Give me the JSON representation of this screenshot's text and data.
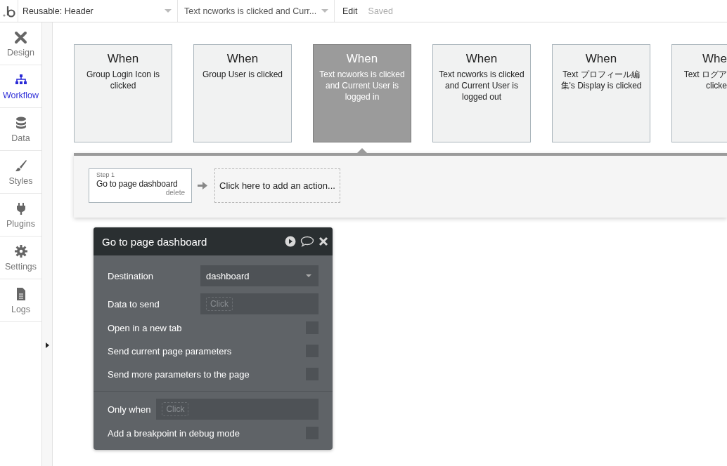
{
  "topbar": {
    "page_dropdown": "Reusable: Header",
    "event_dropdown": "Text ncworks is clicked and Curr...",
    "edit": "Edit",
    "status": "Saved"
  },
  "sidebar": {
    "items": [
      {
        "label": "Design",
        "selected": false
      },
      {
        "label": "Workflow",
        "selected": true
      },
      {
        "label": "Data",
        "selected": false
      },
      {
        "label": "Styles",
        "selected": false
      },
      {
        "label": "Plugins",
        "selected": false
      },
      {
        "label": "Settings",
        "selected": false
      },
      {
        "label": "Logs",
        "selected": false
      }
    ]
  },
  "events": [
    {
      "title": "When",
      "description": "Group Login Icon is clicked",
      "selected": false
    },
    {
      "title": "When",
      "description": "Group User is clicked",
      "selected": false
    },
    {
      "title": "When",
      "description": "Text ncworks is clicked and Current User is logged in",
      "selected": true
    },
    {
      "title": "When",
      "description": "Text ncworks is clicked and Current User is logged out",
      "selected": false
    },
    {
      "title": "When",
      "description": "Text プロフィール編集's Display is clicked",
      "selected": false
    },
    {
      "title": "Whe",
      "description": "Text ログア\nclicke",
      "selected": false
    }
  ],
  "workflow": {
    "steps": [
      {
        "step": "Step 1",
        "name": "Go to page dashboard",
        "delete": "delete"
      }
    ],
    "add_action": "Click here to add an action..."
  },
  "action_editor": {
    "title": "Go to page dashboard",
    "fields": [
      {
        "kind": "dropdown",
        "label": "Destination",
        "value": "dashboard"
      },
      {
        "kind": "expression",
        "label": "Data to send",
        "placeholder": "Click"
      },
      {
        "kind": "checkbox",
        "label": "Open in a new tab",
        "checked": false
      },
      {
        "kind": "checkbox",
        "label": "Send current page parameters",
        "checked": false
      },
      {
        "kind": "checkbox",
        "label": "Send more parameters to the page",
        "checked": false
      }
    ],
    "condition_fields": [
      {
        "kind": "inline-expression",
        "label": "Only when",
        "placeholder": "Click"
      },
      {
        "kind": "checkbox",
        "label": "Add a breakpoint in debug mode",
        "checked": false
      }
    ]
  }
}
